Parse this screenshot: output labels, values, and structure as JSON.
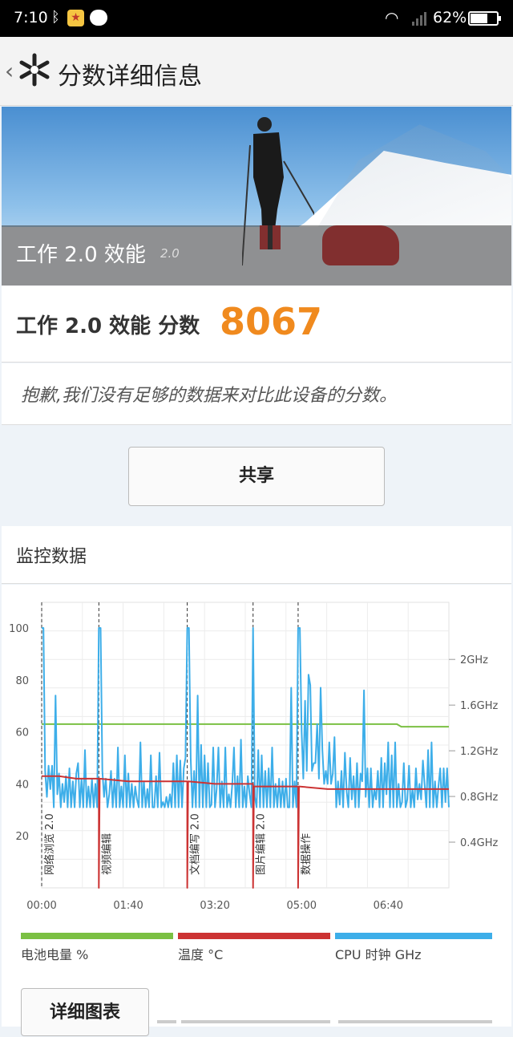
{
  "status_bar": {
    "time": "7:10",
    "battery": "62%",
    "battery_level": 0.62
  },
  "app_bar": {
    "title": "分数详细信息"
  },
  "hero": {
    "title": "工作 2.0 效能",
    "version": "2.0"
  },
  "score": {
    "label": "工作 2.0 效能 分数",
    "value": "8067"
  },
  "notice": "抱歉,我们没有足够的数据来对比此设备的分数。",
  "share_button": "共享",
  "monitor": {
    "title": "监控数据"
  },
  "chart_data": {
    "type": "line",
    "x_ticks": [
      "00:00",
      "01:40",
      "03:20",
      "05:00",
      "06:40"
    ],
    "xlim": [
      0,
      470
    ],
    "y_left_ticks": [
      "100",
      "80",
      "60",
      "40",
      "20"
    ],
    "ylim_left": [
      0,
      100
    ],
    "y_right_ticks": [
      "2GHz",
      "1.6GHz",
      "1.2GHz",
      "0.8GHz",
      "0.4GHz"
    ],
    "ylim_right_ghz": [
      0,
      2.5
    ],
    "markers": [
      {
        "label": "网络浏览 2.0",
        "t": 0
      },
      {
        "label": "视频编辑",
        "t": 66
      },
      {
        "label": "文档编写 2.0",
        "t": 168
      },
      {
        "label": "图片编辑 2.0",
        "t": 244
      },
      {
        "label": "数据操作",
        "t": 296
      }
    ],
    "series": [
      {
        "name": "电池电量 %",
        "color": "#7bc043",
        "points": [
          [
            0,
            63
          ],
          [
            410,
            63
          ],
          [
            415,
            62
          ],
          [
            470,
            62
          ]
        ]
      },
      {
        "name": "温度 °C",
        "color": "#cc3333",
        "points": [
          [
            0,
            43
          ],
          [
            20,
            43
          ],
          [
            40,
            42
          ],
          [
            66,
            42
          ],
          [
            66,
            0
          ],
          [
            67,
            42
          ],
          [
            100,
            41
          ],
          [
            168,
            41
          ],
          [
            168,
            0
          ],
          [
            169,
            41
          ],
          [
            200,
            40
          ],
          [
            244,
            40
          ],
          [
            244,
            0
          ],
          [
            245,
            39
          ],
          [
            296,
            39
          ],
          [
            296,
            0
          ],
          [
            297,
            39
          ],
          [
            330,
            38
          ],
          [
            400,
            38
          ],
          [
            470,
            38
          ]
        ]
      },
      {
        "name": "CPU 时钟 GHz",
        "color": "#3daee9",
        "points": [
          [
            0,
            100
          ],
          [
            2,
            100
          ],
          [
            4,
            45
          ],
          [
            6,
            35
          ],
          [
            8,
            47
          ],
          [
            10,
            38
          ],
          [
            12,
            47
          ],
          [
            14,
            31
          ],
          [
            16,
            74
          ],
          [
            18,
            36
          ],
          [
            20,
            44
          ],
          [
            22,
            31
          ],
          [
            24,
            40
          ],
          [
            26,
            33
          ],
          [
            28,
            43
          ],
          [
            30,
            31
          ],
          [
            32,
            46
          ],
          [
            34,
            31
          ],
          [
            36,
            41
          ],
          [
            38,
            31
          ],
          [
            40,
            44
          ],
          [
            42,
            48
          ],
          [
            44,
            31
          ],
          [
            46,
            42
          ],
          [
            48,
            31
          ],
          [
            50,
            53
          ],
          [
            52,
            31
          ],
          [
            54,
            39
          ],
          [
            56,
            31
          ],
          [
            58,
            42
          ],
          [
            60,
            31
          ],
          [
            62,
            40
          ],
          [
            64,
            31
          ],
          [
            66,
            100
          ],
          [
            68,
            100
          ],
          [
            70,
            45
          ],
          [
            72,
            35
          ],
          [
            74,
            42
          ],
          [
            76,
            31
          ],
          [
            78,
            36
          ],
          [
            80,
            45
          ],
          [
            82,
            31
          ],
          [
            84,
            42
          ],
          [
            86,
            31
          ],
          [
            88,
            54
          ],
          [
            90,
            31
          ],
          [
            92,
            39
          ],
          [
            94,
            31
          ],
          [
            96,
            51
          ],
          [
            98,
            31
          ],
          [
            100,
            44
          ],
          [
            102,
            31
          ],
          [
            104,
            40
          ],
          [
            106,
            31
          ],
          [
            108,
            39
          ],
          [
            110,
            34
          ],
          [
            112,
            31
          ],
          [
            114,
            56
          ],
          [
            116,
            31
          ],
          [
            118,
            41
          ],
          [
            120,
            31
          ],
          [
            122,
            38
          ],
          [
            124,
            31
          ],
          [
            126,
            51
          ],
          [
            128,
            31
          ],
          [
            130,
            31
          ],
          [
            132,
            43
          ],
          [
            134,
            31
          ],
          [
            136,
            52
          ],
          [
            138,
            31
          ],
          [
            140,
            33
          ],
          [
            142,
            31
          ],
          [
            144,
            35
          ],
          [
            146,
            31
          ],
          [
            148,
            36
          ],
          [
            150,
            31
          ],
          [
            152,
            48
          ],
          [
            154,
            31
          ],
          [
            156,
            51
          ],
          [
            158,
            31
          ],
          [
            160,
            49
          ],
          [
            162,
            31
          ],
          [
            164,
            46
          ],
          [
            166,
            50
          ],
          [
            168,
            100
          ],
          [
            170,
            100
          ],
          [
            172,
            50
          ],
          [
            174,
            31
          ],
          [
            176,
            45
          ],
          [
            178,
            31
          ],
          [
            180,
            74
          ],
          [
            182,
            31
          ],
          [
            184,
            55
          ],
          [
            186,
            31
          ],
          [
            188,
            51
          ],
          [
            190,
            31
          ],
          [
            192,
            48
          ],
          [
            194,
            31
          ],
          [
            196,
            32
          ],
          [
            198,
            54
          ],
          [
            200,
            31
          ],
          [
            202,
            38
          ],
          [
            204,
            54
          ],
          [
            206,
            31
          ],
          [
            208,
            41
          ],
          [
            210,
            31
          ],
          [
            212,
            54
          ],
          [
            214,
            31
          ],
          [
            216,
            36
          ],
          [
            218,
            31
          ],
          [
            220,
            40
          ],
          [
            222,
            54
          ],
          [
            224,
            31
          ],
          [
            226,
            43
          ],
          [
            228,
            31
          ],
          [
            230,
            57
          ],
          [
            232,
            31
          ],
          [
            234,
            39
          ],
          [
            236,
            31
          ],
          [
            238,
            43
          ],
          [
            240,
            36
          ],
          [
            242,
            31
          ],
          [
            244,
            100
          ],
          [
            246,
            35
          ],
          [
            248,
            31
          ],
          [
            250,
            53
          ],
          [
            252,
            31
          ],
          [
            254,
            51
          ],
          [
            256,
            31
          ],
          [
            258,
            45
          ],
          [
            260,
            31
          ],
          [
            262,
            46
          ],
          [
            264,
            31
          ],
          [
            266,
            54
          ],
          [
            268,
            31
          ],
          [
            270,
            40
          ],
          [
            272,
            31
          ],
          [
            274,
            42
          ],
          [
            276,
            31
          ],
          [
            278,
            41
          ],
          [
            280,
            31
          ],
          [
            282,
            42
          ],
          [
            284,
            31
          ],
          [
            286,
            31
          ],
          [
            288,
            77
          ],
          [
            290,
            31
          ],
          [
            292,
            41
          ],
          [
            294,
            31
          ],
          [
            296,
            100
          ],
          [
            298,
            100
          ],
          [
            300,
            60
          ],
          [
            302,
            42
          ],
          [
            304,
            72
          ],
          [
            306,
            45
          ],
          [
            308,
            82
          ],
          [
            310,
            78
          ],
          [
            312,
            45
          ],
          [
            314,
            48
          ],
          [
            316,
            48
          ],
          [
            318,
            63
          ],
          [
            320,
            42
          ],
          [
            322,
            77
          ],
          [
            324,
            53
          ],
          [
            326,
            40
          ],
          [
            328,
            45
          ],
          [
            330,
            40
          ],
          [
            332,
            56
          ],
          [
            334,
            40
          ],
          [
            336,
            44
          ],
          [
            338,
            58
          ],
          [
            340,
            31
          ],
          [
            342,
            41
          ],
          [
            344,
            32
          ],
          [
            346,
            45
          ],
          [
            348,
            31
          ],
          [
            350,
            52
          ],
          [
            352,
            37
          ],
          [
            354,
            31
          ],
          [
            356,
            50
          ],
          [
            358,
            34
          ],
          [
            360,
            43
          ],
          [
            362,
            31
          ],
          [
            364,
            48
          ],
          [
            366,
            31
          ],
          [
            368,
            44
          ],
          [
            370,
            41
          ],
          [
            372,
            76
          ],
          [
            374,
            35
          ],
          [
            376,
            46
          ],
          [
            378,
            31
          ],
          [
            380,
            46
          ],
          [
            382,
            31
          ],
          [
            384,
            38
          ],
          [
            386,
            34
          ],
          [
            388,
            45
          ],
          [
            390,
            31
          ],
          [
            392,
            50
          ],
          [
            394,
            31
          ],
          [
            396,
            48
          ],
          [
            398,
            36
          ],
          [
            400,
            56
          ],
          [
            402,
            31
          ],
          [
            404,
            51
          ],
          [
            406,
            31
          ],
          [
            408,
            56
          ],
          [
            410,
            31
          ],
          [
            412,
            40
          ],
          [
            414,
            31
          ],
          [
            416,
            33
          ],
          [
            418,
            48
          ],
          [
            420,
            31
          ],
          [
            422,
            34
          ],
          [
            424,
            47
          ],
          [
            426,
            31
          ],
          [
            428,
            38
          ],
          [
            430,
            31
          ],
          [
            432,
            46
          ],
          [
            434,
            34
          ],
          [
            436,
            40
          ],
          [
            438,
            34
          ],
          [
            440,
            49
          ],
          [
            442,
            40
          ],
          [
            444,
            31
          ],
          [
            446,
            53
          ],
          [
            448,
            31
          ],
          [
            450,
            56
          ],
          [
            452,
            31
          ],
          [
            454,
            41
          ],
          [
            456,
            31
          ],
          [
            458,
            39
          ],
          [
            460,
            46
          ],
          [
            462,
            31
          ],
          [
            464,
            46
          ],
          [
            466,
            33
          ],
          [
            468,
            46
          ],
          [
            470,
            31
          ]
        ]
      }
    ]
  },
  "legend": {
    "battery": "电池电量 %",
    "temp": "温度 °C",
    "cpu": "CPU 时钟 GHz"
  },
  "detail_button": "详细图表"
}
